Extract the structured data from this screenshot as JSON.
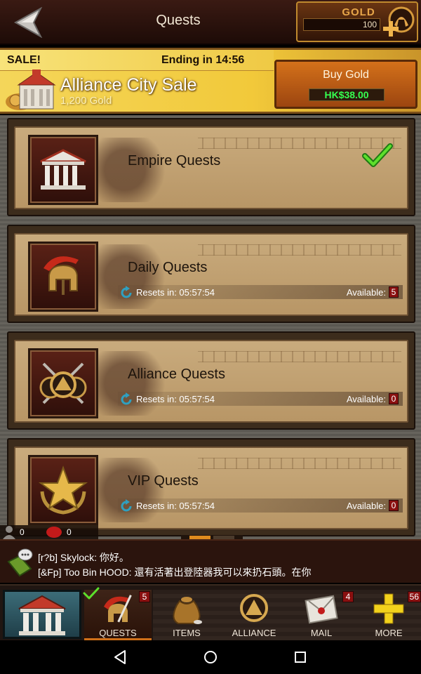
{
  "header": {
    "title": "Quests",
    "back_icon": "back-arrow-icon"
  },
  "gold": {
    "label": "GOLD",
    "amount": "100",
    "add_icon": "gold-plus-helmet-icon"
  },
  "sale": {
    "tag": "SALE!",
    "ending": "Ending in  14:56",
    "title": "Alliance City Sale",
    "subtitle": "1,200 Gold",
    "buy_label": "Buy Gold",
    "price": "HK$38.00",
    "icon": "alliance-city-icon"
  },
  "quests": [
    {
      "title": "Empire Quests",
      "icon": "temple-icon",
      "completed": true
    },
    {
      "title": "Daily Quests",
      "icon": "spartan-helmet-icon",
      "resets": "Resets in: 05:57:54",
      "available_label": "Available:",
      "available": "5"
    },
    {
      "title": "Alliance Quests",
      "icon": "alliance-shield-icon",
      "resets": "Resets in: 05:57:54",
      "available_label": "Available:",
      "available": "0"
    },
    {
      "title": "VIP Quests",
      "icon": "vip-star-icon",
      "resets": "Resets in: 05:57:54",
      "available_label": "Available:",
      "available": "0"
    }
  ],
  "counters": {
    "users": "0",
    "messages": "0"
  },
  "chat": {
    "lines": [
      "[r?b] Skylock: 你好。",
      "[&Fp] Too Bin HOOD: 還有活著出登陸器我可以來扔石頭。在你"
    ]
  },
  "nav": {
    "items": [
      {
        "label": "QUESTS",
        "badge": "5",
        "icon": "quests-helmet-icon",
        "active": true
      },
      {
        "label": "ITEMS",
        "badge": "",
        "icon": "items-bag-icon"
      },
      {
        "label": "ALLIANCE",
        "badge": "",
        "icon": "alliance-icon"
      },
      {
        "label": "MAIL",
        "badge": "4",
        "icon": "mail-icon"
      },
      {
        "label": "MORE",
        "badge": "56",
        "icon": "plus-icon"
      }
    ]
  },
  "colors": {
    "accent_orange": "#d07019",
    "price_green": "#35ff50",
    "badge_red": "#8a1010",
    "banner_yellow": "#f2c93a"
  }
}
